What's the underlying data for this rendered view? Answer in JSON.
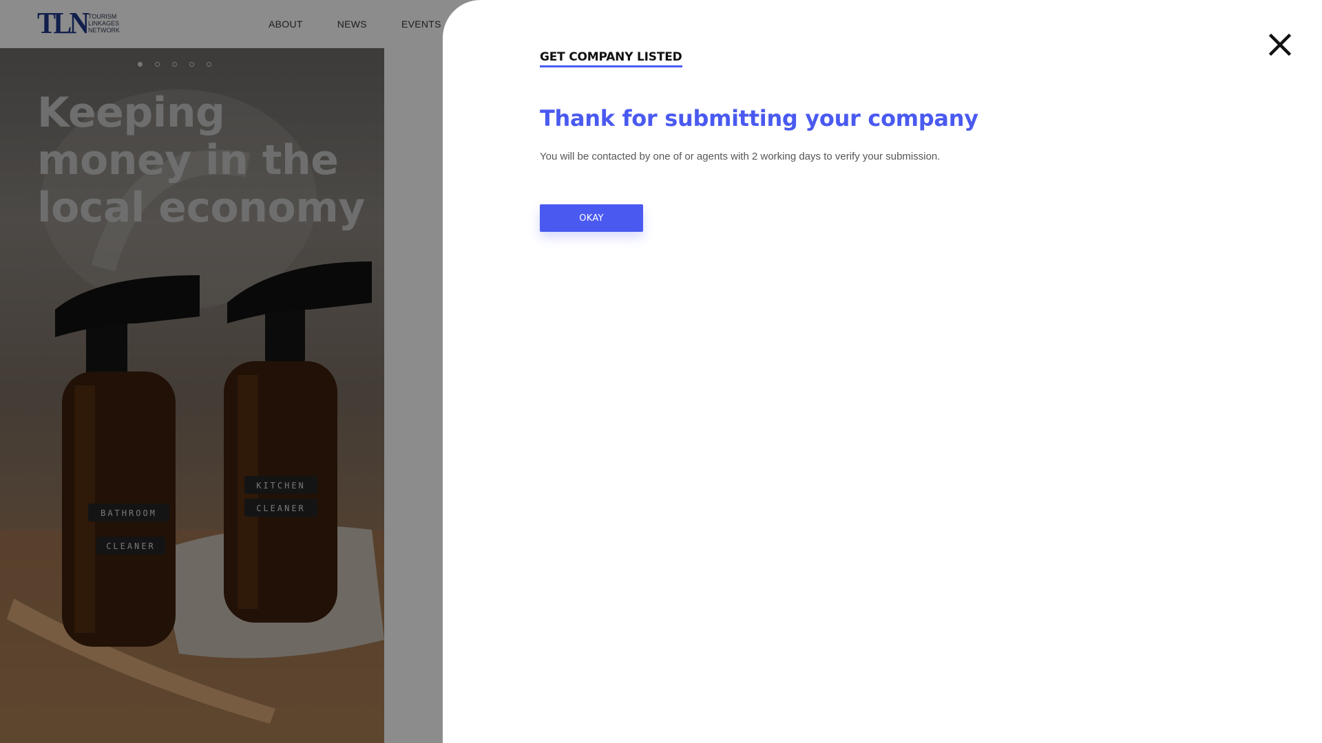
{
  "header": {
    "logo": {
      "mark": "TLN",
      "lines": [
        "TOURISM",
        "LINKAGES",
        "NETWORK"
      ]
    },
    "nav": [
      {
        "label": "ABOUT"
      },
      {
        "label": "NEWS"
      },
      {
        "label": "EVENTS"
      }
    ]
  },
  "hero": {
    "title": "Keeping money in the local economy",
    "carousel": {
      "count": 5,
      "active": 1
    },
    "photo_labels": {
      "left_bottle": [
        "BATHROOM",
        "CLEANER"
      ],
      "right_bottle": [
        "KITCHEN",
        "CLEANER"
      ]
    }
  },
  "modal": {
    "heading": "GET COMPANY LISTED",
    "title": "Thank for submitting your company",
    "message": "You will be contacted by one of or agents with 2 working days to verify your submission.",
    "button": "OKAY",
    "close_icon": "close-icon"
  },
  "colors": {
    "accent": "#4a5af0",
    "logo": "#1f3a8a",
    "overlay": "rgba(0,0,0,0.45)"
  }
}
